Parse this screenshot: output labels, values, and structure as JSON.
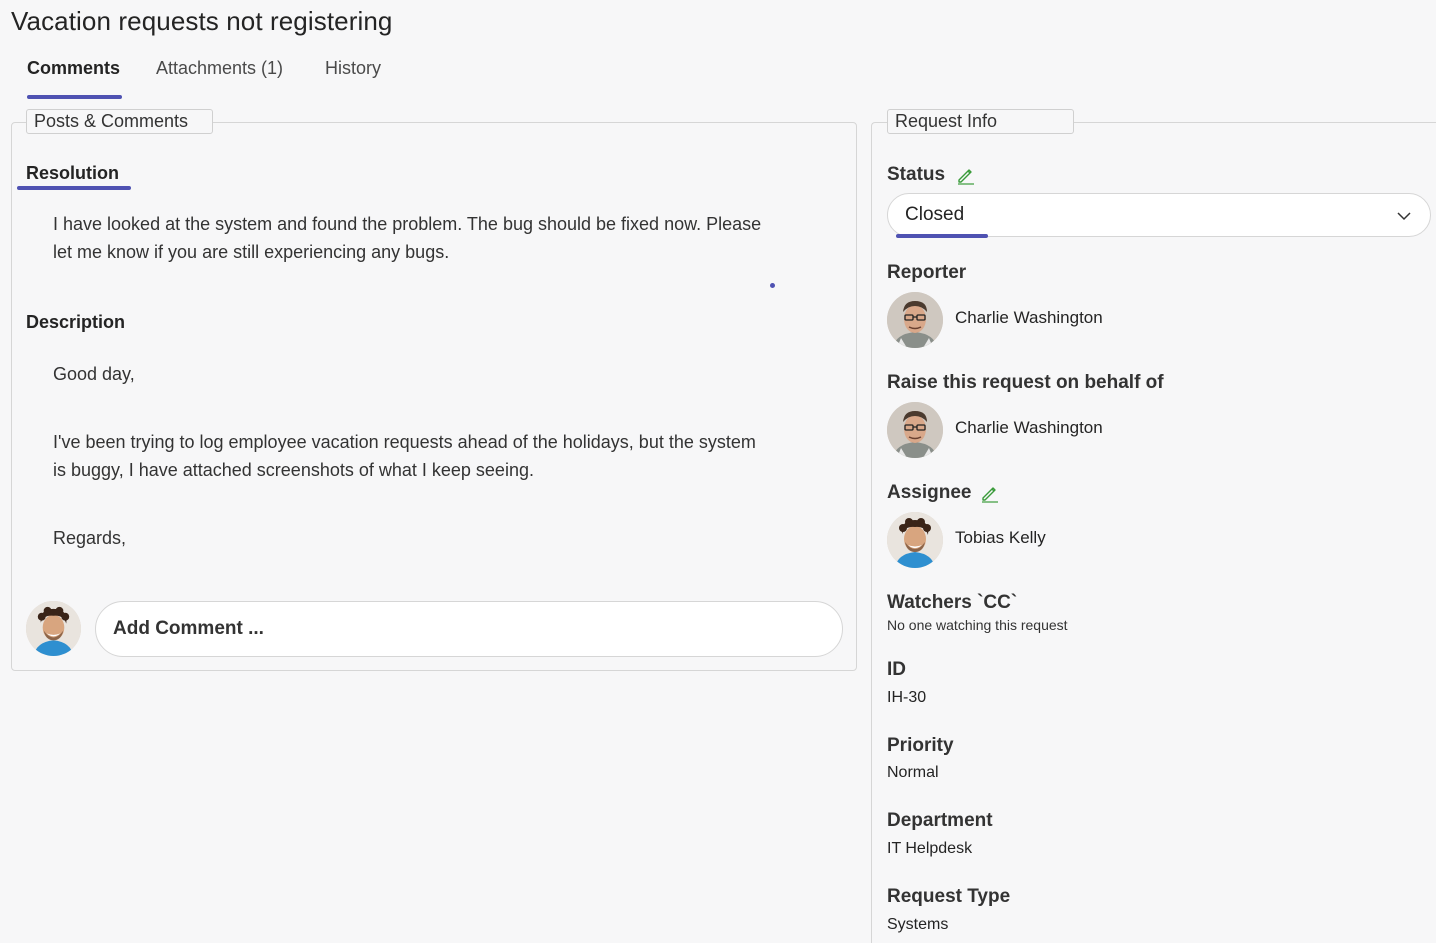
{
  "page": {
    "title": "Vacation requests not registering"
  },
  "tabs": [
    {
      "label": "Comments",
      "active": true
    },
    {
      "label": "Attachments (1)",
      "active": false
    },
    {
      "label": "History",
      "active": false
    }
  ],
  "left": {
    "legend": "Posts & Comments",
    "resolution": {
      "title": "Resolution",
      "lines": [
        "I have looked at the system and found the problem. The bug should be fixed now. Please",
        "let me know if you are still experiencing any bugs."
      ]
    },
    "description": {
      "title": "Description",
      "greeting": "Good day,",
      "lines": [
        "I've been trying to log employee vacation requests ahead of the holidays, but the system",
        "is buggy, I have attached screenshots of what I keep seeing."
      ],
      "closing": "Regards,"
    },
    "comment_placeholder": "Add Comment ..."
  },
  "right": {
    "legend": "Request Info",
    "status": {
      "label": "Status",
      "value": "Closed"
    },
    "reporter": {
      "label": "Reporter",
      "name": "Charlie Washington"
    },
    "behalf": {
      "label": "Raise this request on behalf of",
      "name": "Charlie Washington"
    },
    "assignee": {
      "label": "Assignee",
      "name": "Tobias Kelly"
    },
    "watchers": {
      "label": "Watchers `CC`",
      "value": "No one watching this request"
    },
    "id": {
      "label": "ID",
      "value": "IH-30"
    },
    "priority": {
      "label": "Priority",
      "value": "Normal"
    },
    "department": {
      "label": "Department",
      "value": "IT Helpdesk"
    },
    "request_type": {
      "label": "Request Type",
      "value": "Systems"
    }
  },
  "colors": {
    "accent": "#4f52b2",
    "edit_icon": "#3a9b3a"
  }
}
